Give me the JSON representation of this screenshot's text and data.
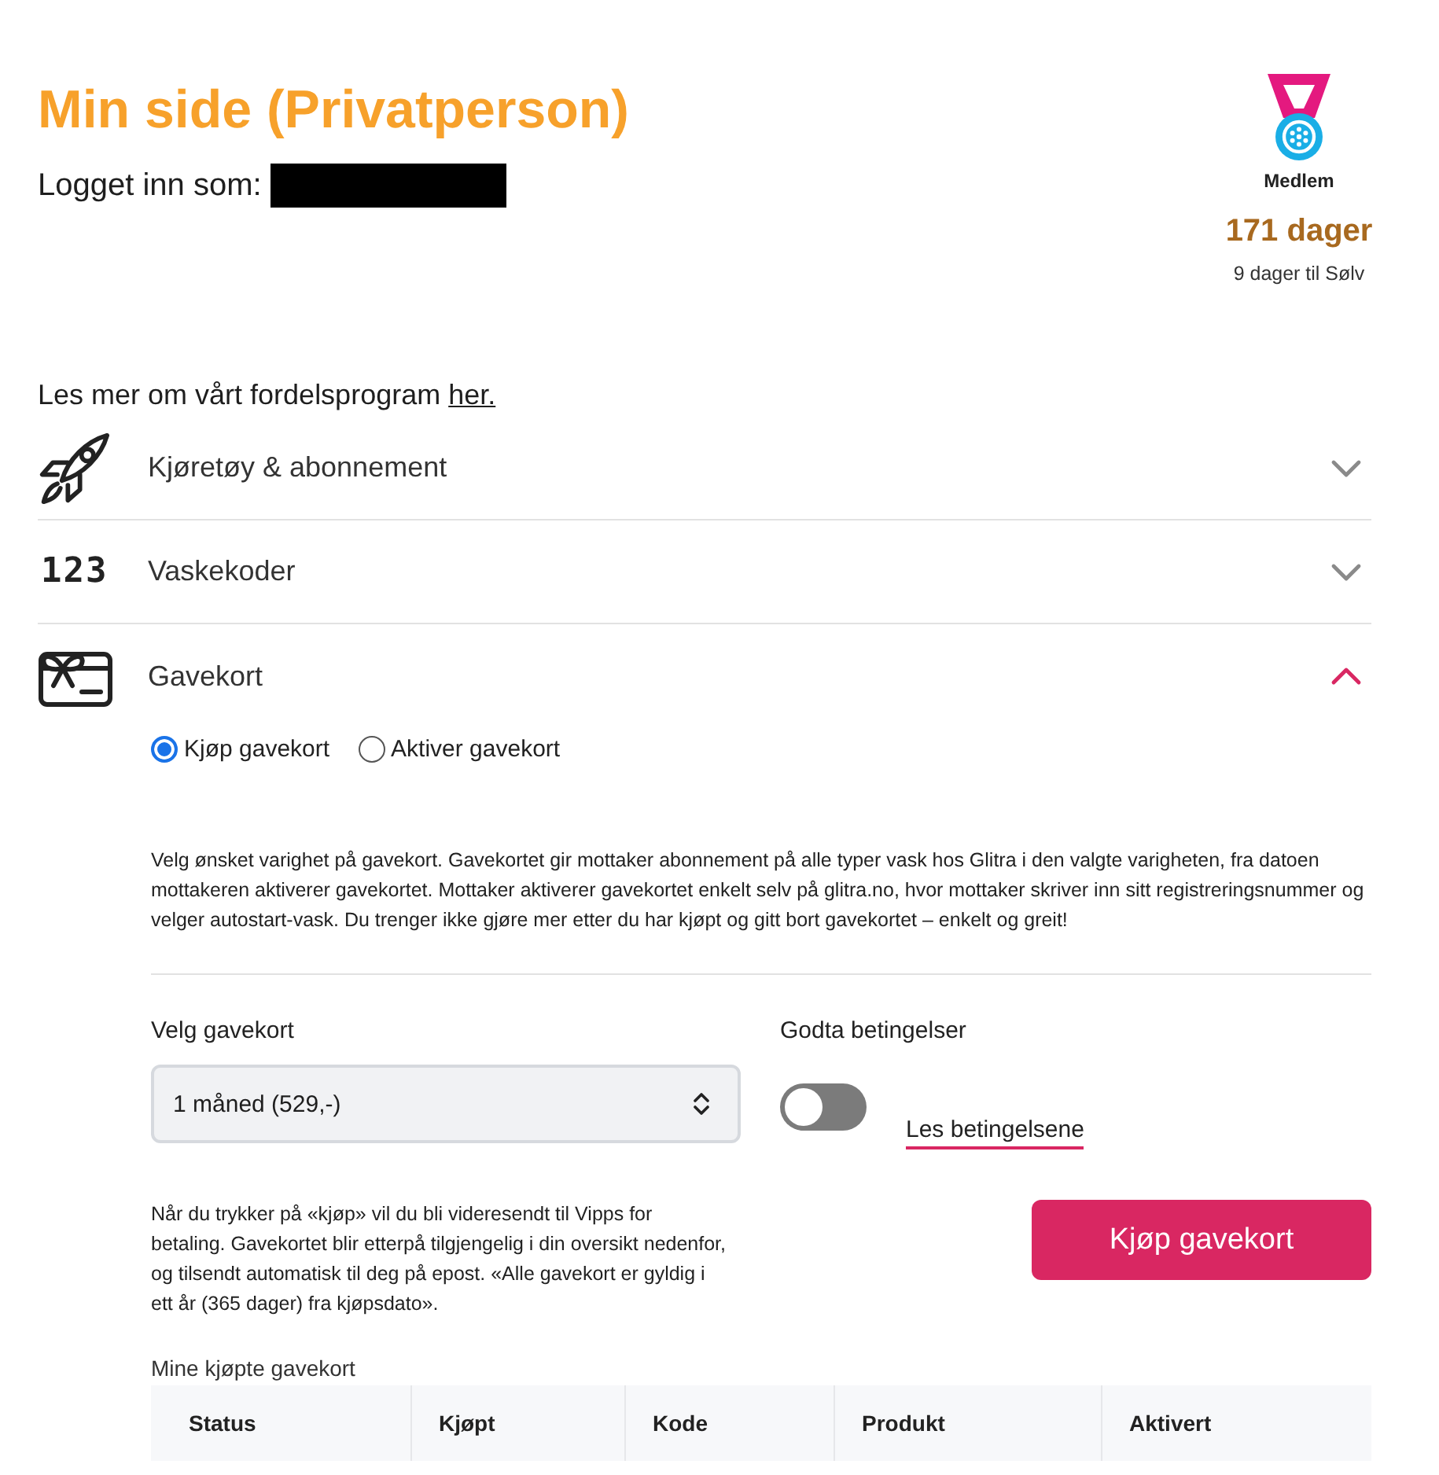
{
  "header": {
    "title": "Min side (Privatperson)",
    "logged_in_label": "Logget inn som:"
  },
  "membership": {
    "level": "Medlem",
    "days": "171 dager",
    "next_level": "9 dager til Sølv"
  },
  "program": {
    "text": "Les mer om vårt fordelsprogram",
    "link": "her."
  },
  "sections": [
    {
      "kind": "rocket",
      "title": "Kjøretøy & abonnement",
      "expanded": false
    },
    {
      "kind": "digits",
      "icon_text": "123",
      "title": "Vaskekoder",
      "expanded": false
    },
    {
      "kind": "gift-card",
      "title": "Gavekort",
      "expanded": true,
      "panel": {
        "modes": [
          {
            "label": "Kjøp gavekort",
            "selected": true
          },
          {
            "label": "Aktiver gavekort",
            "selected": false
          }
        ],
        "description": "Velg ønsket varighet på gavekort. Gavekortet gir mottaker abonnement på alle typer vask hos Glitra i den valgte varigheten, fra datoen mottakeren aktiverer gavekortet. Mottaker aktiverer gavekortet enkelt selv på glitra.no, hvor mottaker skriver inn sitt registreringsnummer og velger autostart-vask. Du trenger ikke gjøre mer etter du har kjøpt og gitt bort gavekortet – enkelt og greit!",
        "select": {
          "label": "Velg gavekort",
          "value": "1 måned (529,-)"
        },
        "terms": {
          "label": "Godta betingelser",
          "on": false,
          "link": "Les betingelsene"
        },
        "note": "Når du trykker på «kjøp» vil du bli videresendt til Vipps for betaling. Gavekortet blir etterpå tilgjengelig i din oversikt nedenfor, og tilsendt automatisk til deg på epost. «Alle gavekort er gyldig i ett år (365 dager) fra kjøpsdato».",
        "buy_button": "Kjøp gavekort",
        "purchases": {
          "title": "Mine kjøpte gavekort",
          "columns": [
            "Status",
            "Kjøpt",
            "Kode",
            "Produkt",
            "Aktivert"
          ]
        }
      }
    }
  ]
}
